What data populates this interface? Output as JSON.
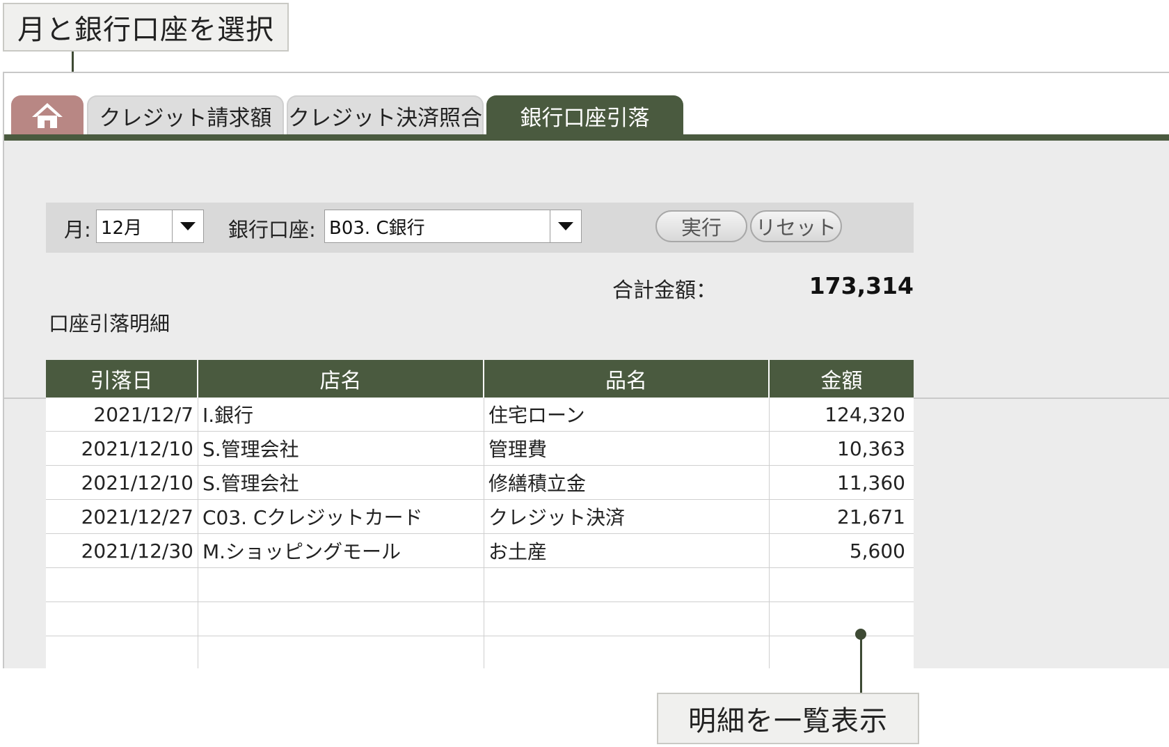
{
  "callouts": {
    "top": "月と銀行口座を選択",
    "bottom": "明細を一覧表示"
  },
  "tabs": [
    {
      "label": "",
      "icon": "home-icon"
    },
    {
      "label": "クレジット請求額"
    },
    {
      "label": "クレジット決済照合"
    },
    {
      "label": "銀行口座引落",
      "active": true
    }
  ],
  "filters": {
    "month_label": "月:",
    "month_value": "12月",
    "bank_label": "銀行口座:",
    "bank_value": "B03. C銀行",
    "execute_label": "実行",
    "reset_label": "リセット"
  },
  "summary": {
    "total_label": "合計金額：",
    "total_value": "173,314"
  },
  "table": {
    "title": "口座引落明細",
    "headers": [
      "引落日",
      "店名",
      "品名",
      "金額"
    ],
    "rows": [
      [
        "2021/12/7",
        "I.銀行",
        "住宅ローン",
        "124,320"
      ],
      [
        "2021/12/10",
        "S.管理会社",
        "管理費",
        "10,363"
      ],
      [
        "2021/12/10",
        "S.管理会社",
        "修繕積立金",
        "11,360"
      ],
      [
        "2021/12/27",
        "C03. Cクレジットカード",
        "クレジット決済",
        "21,671"
      ],
      [
        "2021/12/30",
        "M.ショッピングモール",
        "お土産",
        "5,600"
      ],
      [
        "",
        "",
        "",
        ""
      ],
      [
        "",
        "",
        "",
        ""
      ],
      [
        "",
        "",
        "",
        ""
      ]
    ]
  },
  "colors": {
    "accent": "#4a5a3f",
    "home_tab": "#b88784"
  }
}
